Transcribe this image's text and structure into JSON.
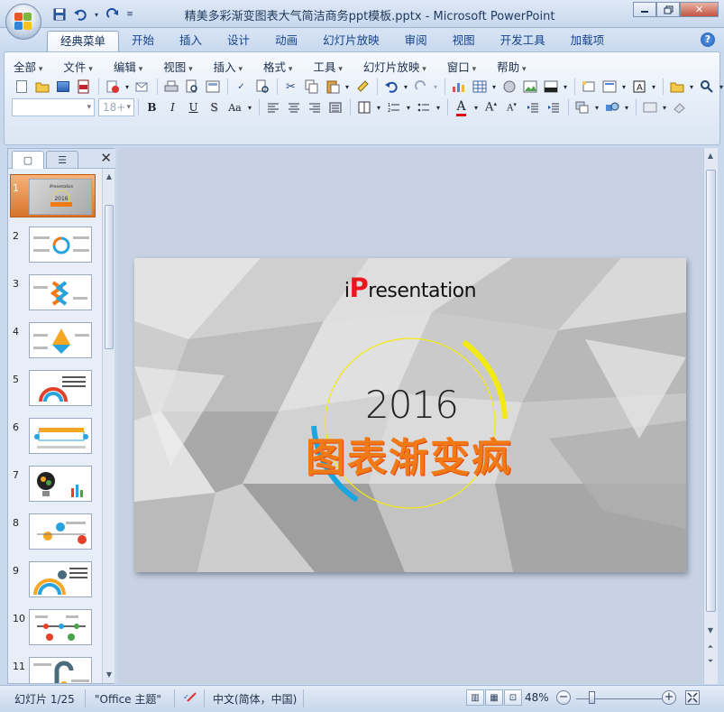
{
  "window": {
    "title": "精美多彩渐变图表大气简洁商务ppt模板.pptx - Microsoft PowerPoint",
    "controls": [
      "minimize",
      "maximize",
      "close"
    ]
  },
  "quick_access": {
    "icons": [
      "save-icon",
      "undo-icon",
      "redo-icon",
      "customize-icon"
    ]
  },
  "ribbon_tabs": [
    "经典菜单",
    "开始",
    "插入",
    "设计",
    "动画",
    "幻灯片放映",
    "审阅",
    "视图",
    "开发工具",
    "加载项"
  ],
  "active_tab": "经典菜单",
  "menus": [
    "全部",
    "文件",
    "编辑",
    "视图",
    "插入",
    "格式",
    "工具",
    "幻灯片放映",
    "窗口",
    "帮助"
  ],
  "format_bar": {
    "font_name": "",
    "font_size": "18+",
    "bold": "B",
    "italic": "I",
    "underline": "U",
    "shadow": "S",
    "case": "Aa",
    "font_color": "A"
  },
  "slides_pane": {
    "tab_slides": "▢",
    "tab_outline": "☰",
    "slides": [
      {
        "num": "1",
        "selected": true
      },
      {
        "num": "2"
      },
      {
        "num": "3"
      },
      {
        "num": "4"
      },
      {
        "num": "5"
      },
      {
        "num": "6"
      },
      {
        "num": "7"
      },
      {
        "num": "8"
      },
      {
        "num": "9"
      },
      {
        "num": "10"
      },
      {
        "num": "11"
      }
    ]
  },
  "slide": {
    "brand_prefix": "i",
    "brand_bold": "P",
    "brand_rest": "resentation",
    "year": "2016",
    "title": "图表渐变疯",
    "colors": {
      "accent_orange": "#f27a16",
      "ring_yellow": "#f3ea12",
      "ring_blue": "#1aa7e0",
      "brand_red": "#e8181e"
    }
  },
  "status": {
    "slide_info": "幻灯片 1/25",
    "theme": "\"Office 主题\"",
    "language": "中文(简体，中国)",
    "zoom": "48%",
    "zoom_level_percent": 48
  }
}
